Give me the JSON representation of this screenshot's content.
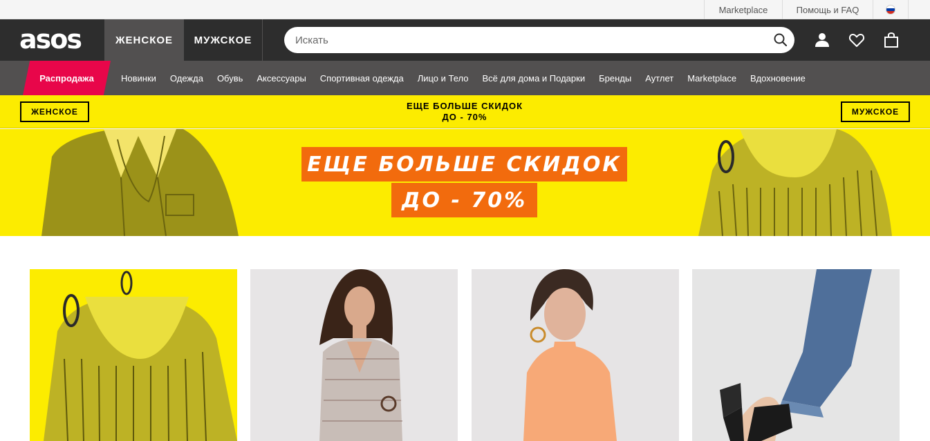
{
  "topbar": {
    "marketplace": "Marketplace",
    "help": "Помощь и FAQ",
    "country_flag_icon": "russia-flag-icon"
  },
  "header": {
    "logo": "asos",
    "tabs": {
      "women": "ЖЕНСКОЕ",
      "men": "МУЖСКОЕ"
    },
    "search": {
      "placeholder": "Искать",
      "value": ""
    },
    "icons": [
      "search-icon",
      "account-icon",
      "heart-icon",
      "bag-icon"
    ]
  },
  "nav": {
    "sale": "Распродажа",
    "items": [
      "Новинки",
      "Одежда",
      "Обувь",
      "Аксессуары",
      "Спортивная одежда",
      "Лицо и Тело",
      "Всё для дома и Подарки",
      "Бренды",
      "Аутлет",
      "Marketplace",
      "Вдохновение"
    ]
  },
  "promo": {
    "women_button": "ЖЕНСКОЕ",
    "men_button": "МУЖСКОЕ",
    "line1": "ЕЩЕ БОЛЬШЕ СКИДОК",
    "line2": "ДО - 70%"
  },
  "hero": {
    "headline": "ЕЩЕ БОЛЬШЕ СКИДОК",
    "subline": "ДО - 70%"
  },
  "colors": {
    "header_bg": "#2d2d2d",
    "nav_bg": "#525050",
    "sale_red": "#e8064a",
    "promo_yellow": "#fcec00",
    "hero_orange": "#f26b0d"
  }
}
